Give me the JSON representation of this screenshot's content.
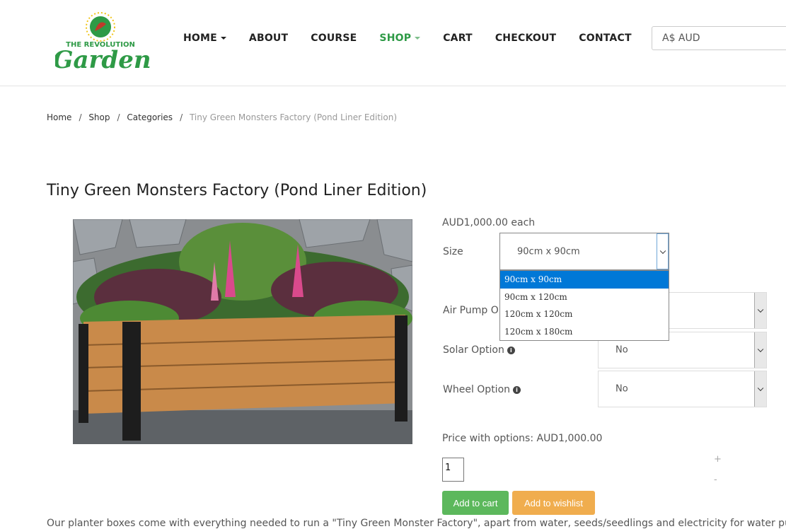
{
  "logo": {
    "line1": "THE REVOLUTION",
    "line2": "Garden"
  },
  "nav": {
    "items": [
      {
        "label": "HOME",
        "caret": true,
        "active": false
      },
      {
        "label": "ABOUT",
        "caret": false,
        "active": false
      },
      {
        "label": "COURSE",
        "caret": false,
        "active": false
      },
      {
        "label": "SHOP",
        "caret": true,
        "active": true
      },
      {
        "label": "CART",
        "caret": false,
        "active": false
      },
      {
        "label": "CHECKOUT",
        "caret": false,
        "active": false
      },
      {
        "label": "CONTACT",
        "caret": false,
        "active": false
      }
    ]
  },
  "currency": {
    "value": "A$ AUD"
  },
  "breadcrumb": {
    "home": "Home",
    "shop": "Shop",
    "categories": "Categories",
    "current": "Tiny Green Monsters Factory (Pond Liner Edition)"
  },
  "product": {
    "title": "Tiny Green Monsters Factory (Pond Liner Edition)",
    "price_each": "AUD1,000.00 each",
    "size_label": "Size",
    "size_value": "90cm x 90cm",
    "size_options": [
      "90cm x 90cm",
      "90cm x 120cm",
      "120cm x 120cm",
      "120cm x 180cm"
    ],
    "air_label": "Air Pump Op",
    "solar_label": "Solar Option",
    "solar_value": "No",
    "wheel_label": "Wheel Option",
    "wheel_value": "No",
    "price_with_options": "Price with options: AUD1,000.00",
    "quantity": "1",
    "plus": "+",
    "minus": "-",
    "add_to_cart": "Add to cart",
    "add_to_wishlist": "Add to wishlist",
    "description": "Our planter boxes come with everything needed to run a \"Tiny Green Monster Factory\", apart from water, seeds/seedlings and electricity for water pump and"
  },
  "colors": {
    "accent": "#2e9a46",
    "cart": "#5cb85c",
    "wishlist": "#f0ad4e",
    "selected": "#0078d7"
  }
}
